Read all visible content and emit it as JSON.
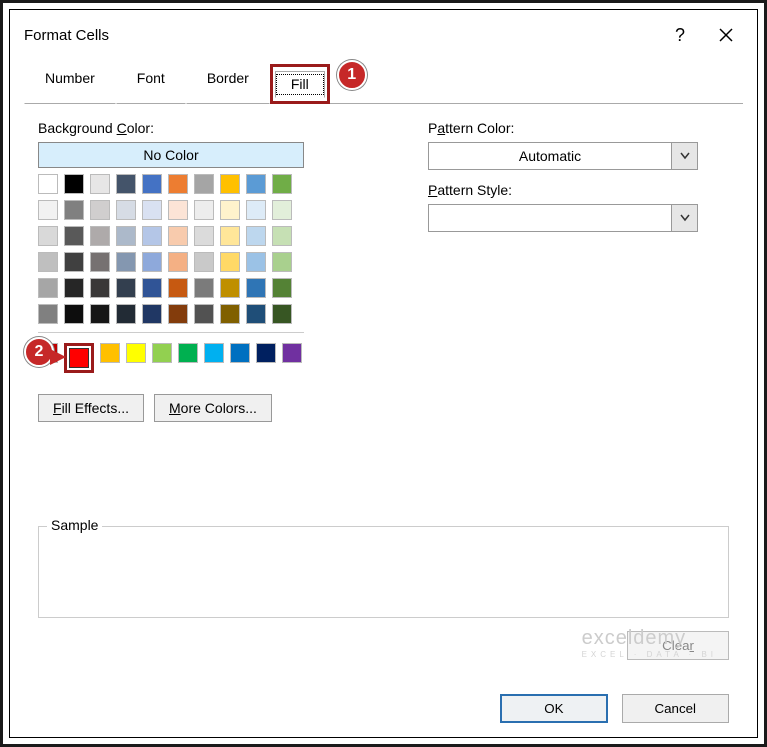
{
  "title": "Format Cells",
  "help_icon": "?",
  "tabs": {
    "number": "Number",
    "font": "Font",
    "border": "Border",
    "fill": "Fill"
  },
  "callouts": {
    "one": "1",
    "two": "2"
  },
  "labels": {
    "bg_prefix": "Background ",
    "bg_u": "C",
    "bg_suffix": "olor:",
    "nocolor": "No Color",
    "pc_prefix": "P",
    "pc_u": "a",
    "pc_suffix": "ttern Color:",
    "pc_value": "Automatic",
    "ps_u": "P",
    "ps_suffix": "attern Style:",
    "fill_u": "F",
    "fill_suffix": "ill Effects...",
    "more_u": "M",
    "more_suffix": "ore Colors...",
    "sample": "Sample",
    "clear_prefix": "Clea",
    "clear_u": "r",
    "ok": "OK",
    "cancel": "Cancel"
  },
  "watermark": {
    "main": "exceldemy",
    "sub": "EXCEL · DATA · BI"
  },
  "theme_row1": [
    "#ffffff",
    "#000000",
    "#e7e6e6",
    "#44546a",
    "#4472c4",
    "#ed7d31",
    "#a5a5a5",
    "#ffc000",
    "#5b9bd5",
    "#70ad47"
  ],
  "tints": [
    [
      "#f2f2f2",
      "#808080",
      "#d0cece",
      "#d6dce5",
      "#d9e1f2",
      "#fce4d6",
      "#ededed",
      "#fff2cc",
      "#ddebf7",
      "#e2efda"
    ],
    [
      "#d9d9d9",
      "#595959",
      "#aeaaaa",
      "#acb9ca",
      "#b4c6e7",
      "#f8cbad",
      "#dbdbdb",
      "#ffe699",
      "#bdd7ee",
      "#c6e0b4"
    ],
    [
      "#bfbfbf",
      "#404040",
      "#767171",
      "#8497b0",
      "#8ea9db",
      "#f4b084",
      "#c9c9c9",
      "#ffd966",
      "#9bc2e6",
      "#a9d08e"
    ],
    [
      "#a6a6a6",
      "#262626",
      "#3a3838",
      "#333f4f",
      "#305496",
      "#c65911",
      "#7b7b7b",
      "#bf8f00",
      "#2f75b5",
      "#548235"
    ],
    [
      "#808080",
      "#0d0d0d",
      "#161616",
      "#222b35",
      "#203764",
      "#833c0c",
      "#525252",
      "#806000",
      "#1f4e78",
      "#375623"
    ]
  ],
  "standard": [
    "#c00000",
    "#ff0000",
    "#ffc000",
    "#ffff00",
    "#92d050",
    "#00b050",
    "#00b0f0",
    "#0070c0",
    "#002060",
    "#7030a0"
  ]
}
